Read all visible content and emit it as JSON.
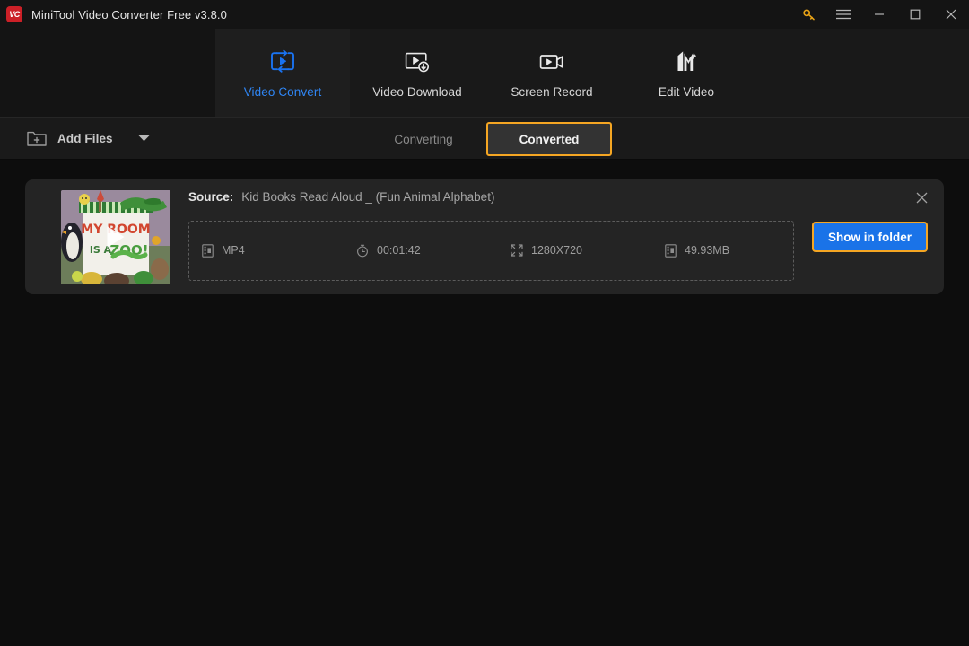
{
  "window": {
    "title": "MiniTool Video Converter Free v3.8.0",
    "logo_text": "VC",
    "controls": {
      "key_icon": "key-icon",
      "menu_icon": "hamburger-menu-icon",
      "minimize_icon": "minimize-icon",
      "maximize_icon": "maximize-icon",
      "close_icon": "close-icon"
    }
  },
  "nav": {
    "items": [
      {
        "label": "Video Convert",
        "icon": "video-convert-icon",
        "active": true
      },
      {
        "label": "Video Download",
        "icon": "video-download-icon",
        "active": false
      },
      {
        "label": "Screen Record",
        "icon": "screen-record-icon",
        "active": false
      },
      {
        "label": "Edit Video",
        "icon": "edit-video-icon",
        "active": false
      }
    ]
  },
  "toolbar": {
    "add_files_label": "Add Files",
    "add_files_icon": "folder-plus-icon",
    "dropdown_icon": "chevron-down-icon",
    "tabs": [
      {
        "label": "Converting",
        "active": false
      },
      {
        "label": "Converted",
        "active": true
      }
    ]
  },
  "task": {
    "source_label": "Source:",
    "source_name": "Kid Books Read Aloud _ (Fun Animal Alphabet)",
    "thumbnail_alt": "MY ROOM IS A ZOO! book cover",
    "thumbnail_title_line1": "MY ROOM",
    "thumbnail_title_line2": "IS A ZOO!",
    "meta": [
      {
        "icon": "file-format-icon",
        "value": "MP4"
      },
      {
        "icon": "clock-icon",
        "value": "00:01:42"
      },
      {
        "icon": "resolution-icon",
        "value": "1280X720"
      },
      {
        "icon": "file-size-icon",
        "value": "49.93MB"
      }
    ],
    "action_button": "Show in folder",
    "close_icon": "close-icon"
  },
  "colors": {
    "accent_blue": "#1a73e8",
    "accent_gold": "#f5a623",
    "brand_red": "#cc2027",
    "window_bg": "#0d0d0d",
    "card_bg": "#242424"
  }
}
